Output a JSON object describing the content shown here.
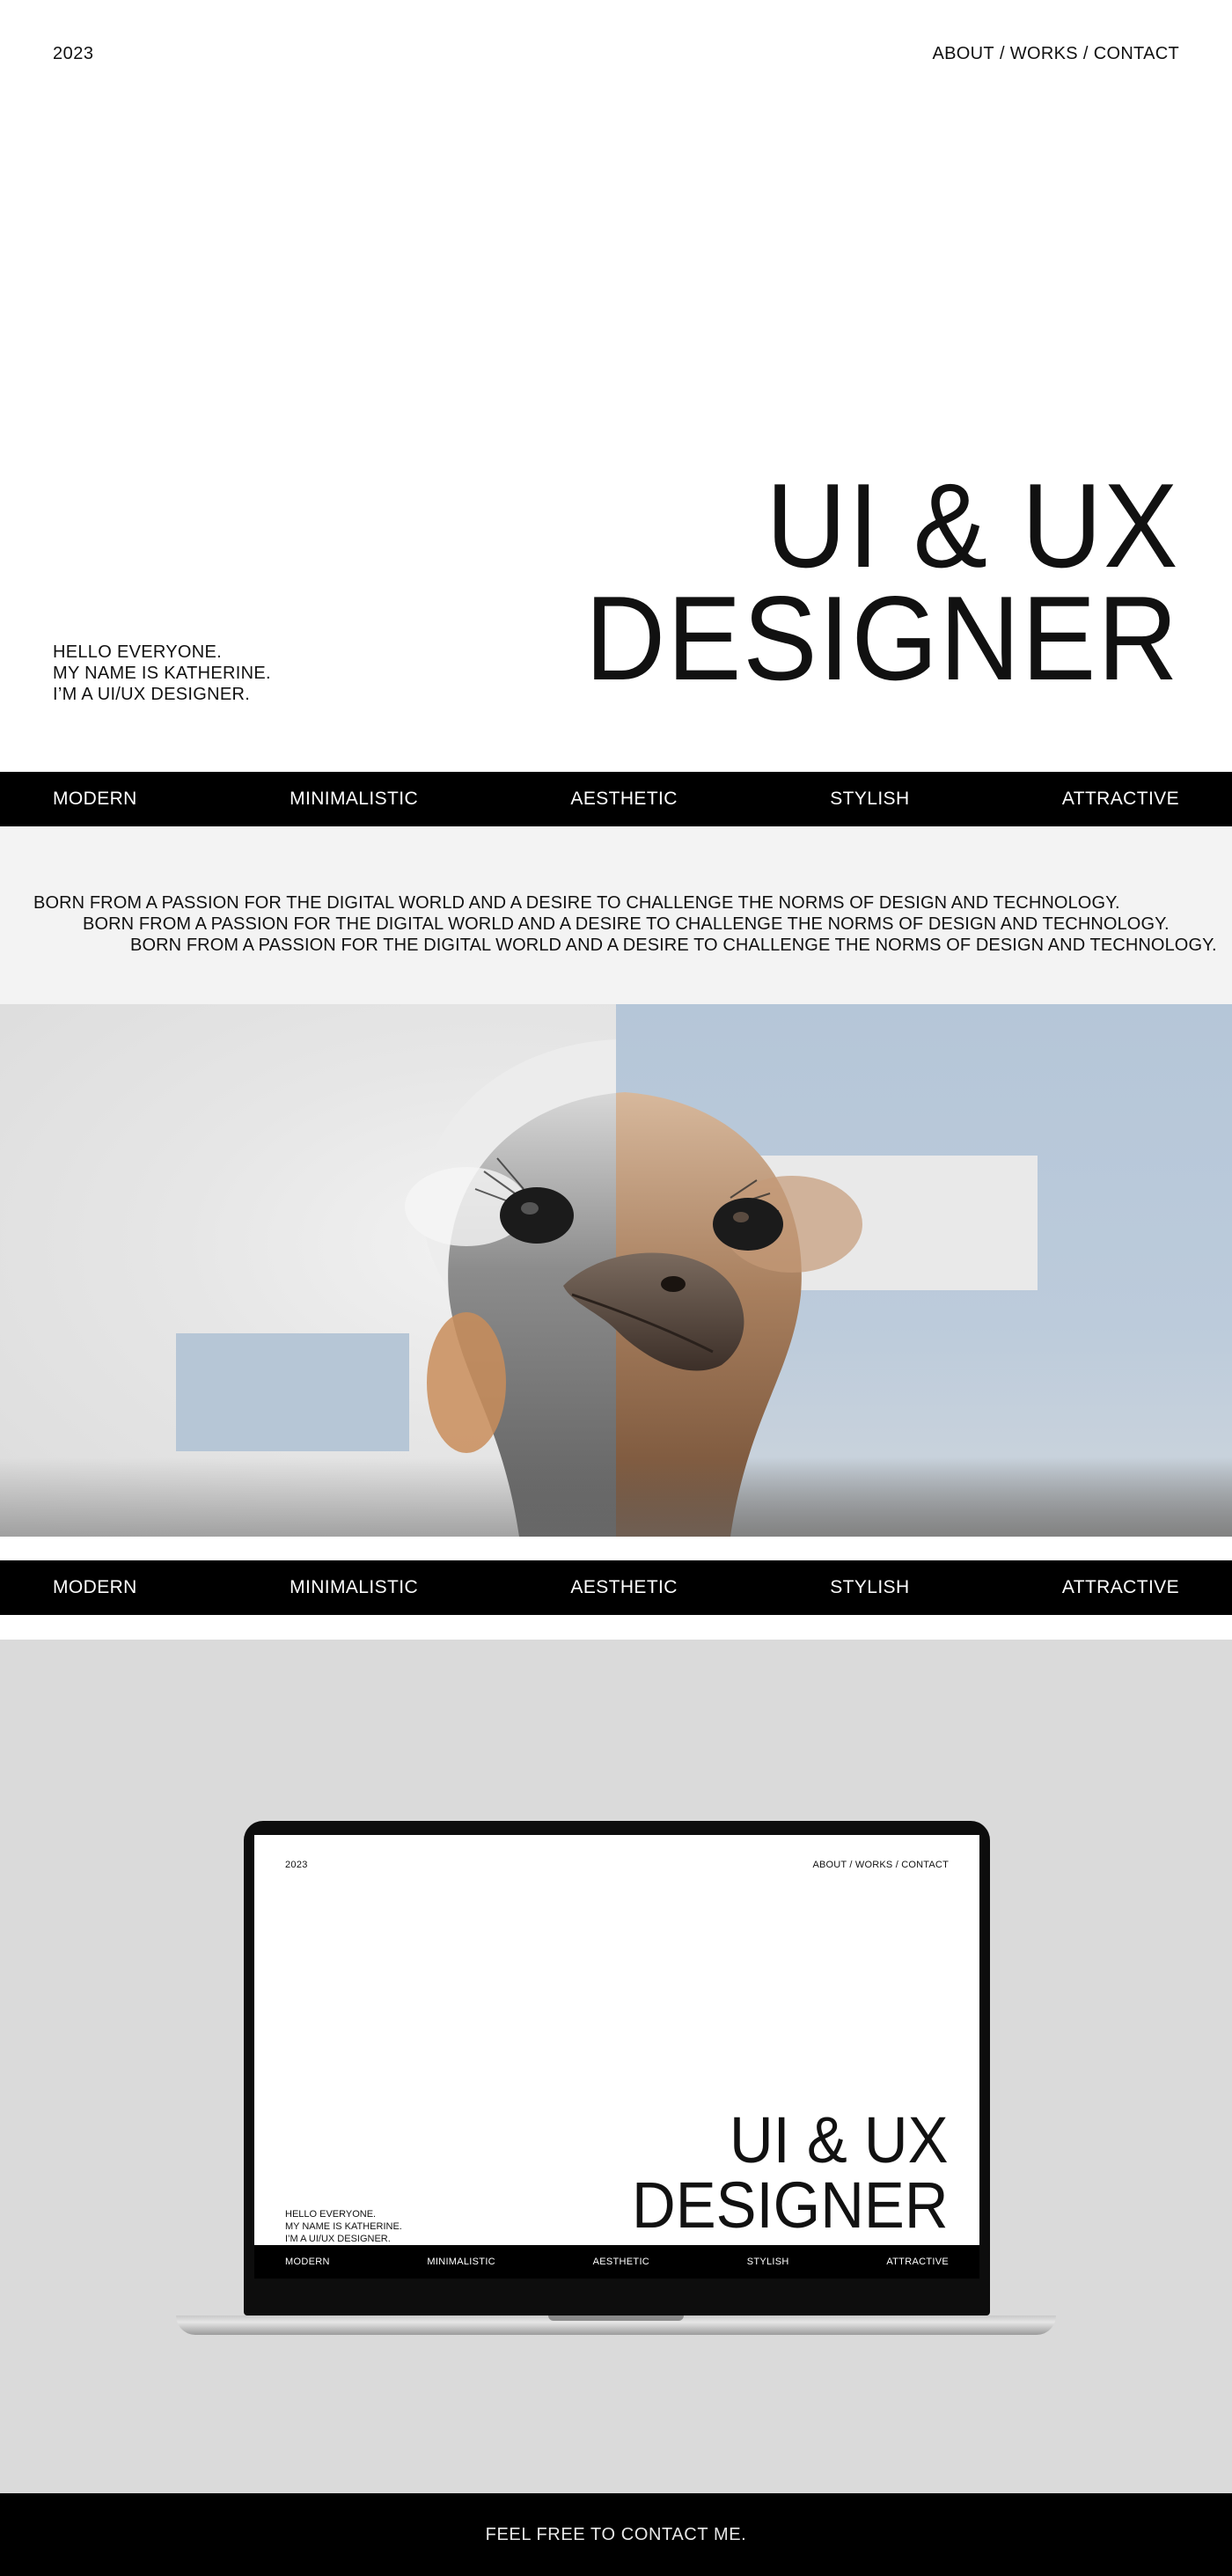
{
  "header": {
    "year": "2023",
    "nav": [
      {
        "label": "ABOUT"
      },
      {
        "label": "WORKS"
      },
      {
        "label": "CONTACT"
      }
    ],
    "separator": "/"
  },
  "hero": {
    "intro_lines": [
      "HELLO EVERYONE.",
      "MY NAME IS KATHERINE.",
      "I’M A UI/UX DESIGNER."
    ],
    "title_lines": [
      "UI & UX",
      "DESIGNER"
    ]
  },
  "band": {
    "items": [
      "MODERN",
      "MINIMALISTIC",
      "AESTHETIC",
      "STYLISH",
      "ATTRACTIVE"
    ]
  },
  "statement": {
    "lines": [
      "BORN FROM A PASSION FOR THE DIGITAL WORLD AND A DESIRE TO CHALLENGE THE NORMS OF DESIGN AND TECHNOLOGY.",
      "BORN FROM A PASSION FOR THE DIGITAL WORLD AND A DESIRE TO CHALLENGE THE NORMS OF DESIGN AND TECHNOLOGY.",
      "BORN FROM A PASSION FOR THE DIGITAL WORLD AND A DESIRE TO CHALLENGE THE NORMS OF DESIGN AND TECHNOLOGY."
    ]
  },
  "photo": {
    "subject": "ostrich-head",
    "colors": {
      "left_bg": "#e4e4e4",
      "right_bg": "#b8c8d8",
      "blue_block": "#b6c6d6",
      "white_block": "#e9e9e9"
    }
  },
  "mockup": {
    "year": "2023",
    "nav_text": "ABOUT / WORKS / CONTACT",
    "intro_lines": [
      "HELLO EVERYONE.",
      "MY NAME IS KATHERINE.",
      "I’M A UI/UX DESIGNER."
    ],
    "title_lines": [
      "UI & UX",
      "DESIGNER"
    ],
    "band_items": [
      "MODERN",
      "MINIMALISTIC",
      "AESTHETIC",
      "STYLISH",
      "ATTRACTIVE"
    ]
  },
  "footer": {
    "text": "FEEL FREE TO CONTACT ME."
  }
}
